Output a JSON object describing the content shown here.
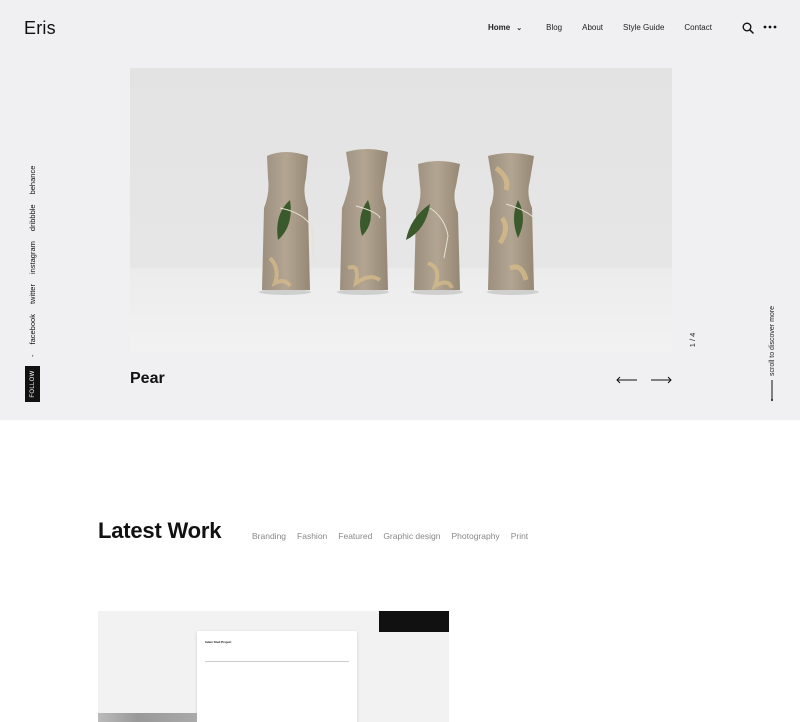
{
  "brand": {
    "logo": "Eris"
  },
  "nav": {
    "items": [
      "Home",
      "Blog",
      "About",
      "Style Guide",
      "Contact"
    ],
    "active": "Home"
  },
  "header_icons": [
    "search-icon",
    "more-dots-icon"
  ],
  "social": {
    "links": [
      "behance",
      "dribbble",
      "instagram",
      "twitter",
      "facebook"
    ],
    "separator": "-",
    "follow_label": "FOLLOW"
  },
  "slider": {
    "title": "Pear",
    "counter": "1 / 4",
    "scroll_hint": "scroll to discover more"
  },
  "latest": {
    "title": "Latest Work",
    "filters": [
      "Branding",
      "Fashion",
      "Featured",
      "Graphic design",
      "Photography",
      "Print"
    ]
  },
  "work_card": {
    "doc_title": "Index Stud Project"
  },
  "colors": {
    "hero_bg": "#f0f0f2",
    "text": "#111111",
    "filter_text": "#888888"
  }
}
